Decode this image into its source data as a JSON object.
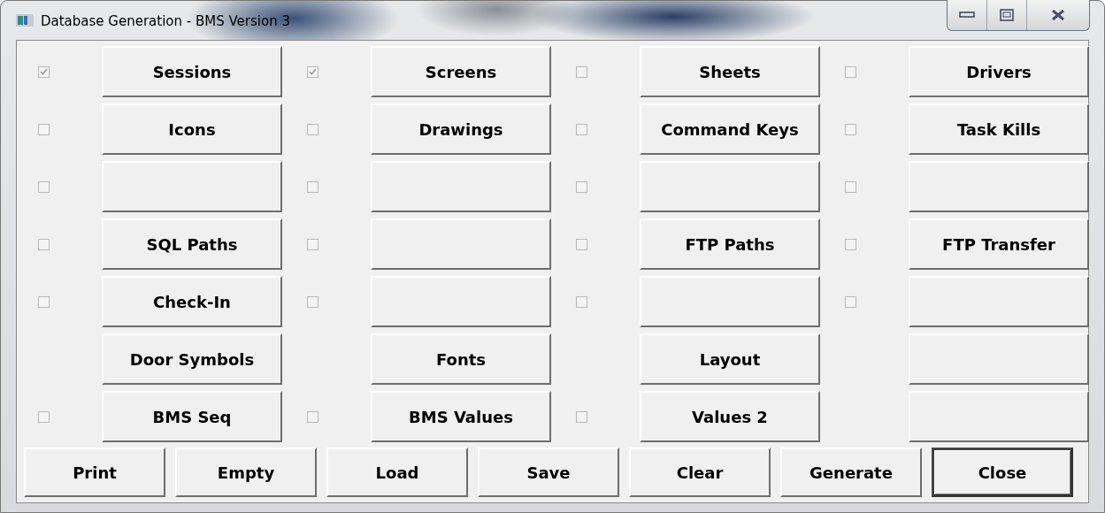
{
  "window": {
    "title": "Database Generation - BMS Version 3"
  },
  "grid": [
    [
      {
        "kind": "checkbox",
        "checked": true,
        "label": "Sessions"
      },
      {
        "kind": "checkbox",
        "checked": true,
        "label": "Screens"
      },
      {
        "kind": "checkbox",
        "checked": false,
        "label": "Sheets"
      },
      {
        "kind": "checkbox",
        "checked": false,
        "label": "Drivers"
      }
    ],
    [
      {
        "kind": "checkbox",
        "checked": false,
        "label": "Icons"
      },
      {
        "kind": "checkbox",
        "checked": false,
        "label": "Drawings"
      },
      {
        "kind": "checkbox",
        "checked": false,
        "label": "Command Keys"
      },
      {
        "kind": "checkbox",
        "checked": false,
        "label": "Task Kills"
      }
    ],
    [
      {
        "kind": "checkbox",
        "checked": false
      },
      {
        "kind": "checkbox",
        "checked": false
      },
      {
        "kind": "checkbox",
        "checked": false
      },
      {
        "kind": "checkbox",
        "checked": false
      }
    ],
    [
      {
        "kind": "checkbox",
        "checked": false,
        "label": "SQL Paths"
      },
      {
        "kind": "checkbox",
        "checked": false
      },
      {
        "kind": "checkbox",
        "checked": false,
        "label": "FTP Paths"
      },
      {
        "kind": "checkbox",
        "checked": false,
        "label": "FTP Transfer"
      }
    ],
    [
      {
        "kind": "checkbox",
        "checked": false,
        "label": "Check-In"
      },
      {
        "kind": "checkbox",
        "checked": false
      },
      {
        "kind": "checkbox",
        "checked": false
      },
      {
        "kind": "checkbox",
        "checked": false
      }
    ],
    [
      {
        "kind": "plain",
        "label": "Door Symbols"
      },
      {
        "kind": "plain",
        "label": "Fonts"
      },
      {
        "kind": "plain",
        "label": "Layout"
      },
      {
        "kind": "plain"
      }
    ],
    [
      {
        "kind": "checkbox",
        "checked": false,
        "label": "BMS Seq"
      },
      {
        "kind": "checkbox",
        "checked": false,
        "label": "BMS Values"
      },
      {
        "kind": "checkbox",
        "checked": false,
        "label": "Values 2"
      },
      {
        "kind": "plain"
      }
    ]
  ],
  "buttons": [
    {
      "label": "Print",
      "default": false
    },
    {
      "label": "Empty",
      "default": false
    },
    {
      "label": "Load",
      "default": false
    },
    {
      "label": "Save",
      "default": false
    },
    {
      "label": "Clear",
      "default": false
    },
    {
      "label": "Generate",
      "default": false
    },
    {
      "label": "Close",
      "default": true
    }
  ]
}
